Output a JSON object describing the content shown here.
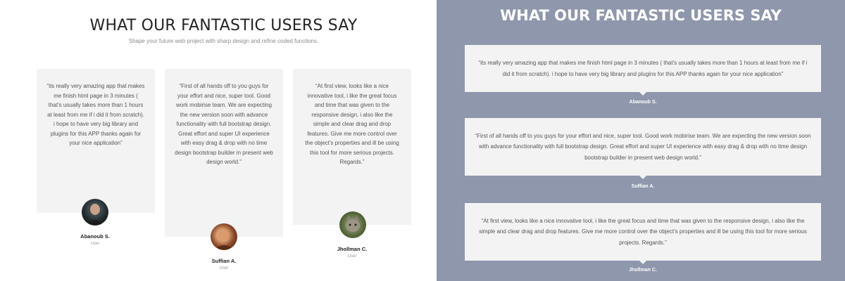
{
  "left": {
    "title": "WHAT OUR FANTASTIC USERS SAY",
    "subtitle": "Shape your future web project with sharp design and refine coded functions.",
    "cards": [
      {
        "quote": "“its really very amazing app that makes me finish html page in 3 minutes ( that's usually takes more than 1 hours at least from me if i did it from scratch). i hope to have very big library and plugins for this APP thanks again for your nice application”",
        "name": "Abanoub S.",
        "role": "User"
      },
      {
        "quote": "“First of all hands off to you guys for your effort and nice, super tool. Good work mobirise team. We are expecting the new version soon with advance functionality with full bootstrap design. Great effort and super UI experience with easy drag & drop with no time design bootstrap builder in present web design world.”",
        "name": "Suffian A.",
        "role": "User"
      },
      {
        "quote": "“At first view, looks like a nice innovative tool, i like the great focus and time that was given to the responsive design, i also like the simple and clear drag and drop features. Give me more control over the object's properties and ill be using this tool for more serious projects. Regards.”",
        "name": "Jhollman C.",
        "role": "User"
      }
    ]
  },
  "right": {
    "title": "WHAT OUR FANTASTIC USERS SAY",
    "items": [
      {
        "quote": "“its really very amazing app that makes me finish html page in 3 minutes ( that's usually takes more than 1 hours at least from me if i did it from scratch). i hope to have very big library and plugins for this APP thanks again for your nice application”",
        "name": "Abanoub S."
      },
      {
        "quote": "“First of all hands off to you guys for your effort and nice, super tool. Good work mobirise team. We are expecting the new version soon with advance functionality with full bootstrap design. Great effort and super UI experience with easy drag & drop with no time design bootstrap builder in present web design world.”",
        "name": "Suffian A."
      },
      {
        "quote": "“At first view, looks like a nice innovative tool, i like the great focus and time that was given to the responsive design, i also like the simple and clear drag and drop features. Give me more control over the object's properties and ill be using this tool for more serious projects. Regards.”",
        "name": "Jhollman C."
      }
    ]
  },
  "colors": {
    "card_bg": "#f3f3f3",
    "right_bg": "#8e97ac",
    "title_dark": "#232323"
  },
  "icons": [
    "avatar-abanoub",
    "avatar-suffian",
    "avatar-jhollman"
  ]
}
